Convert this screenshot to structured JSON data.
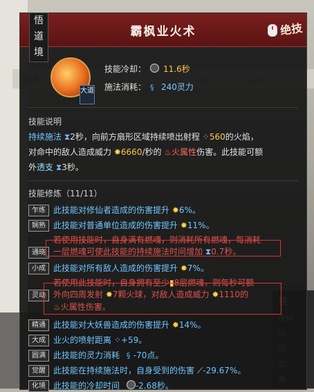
{
  "vertical_tag": [
    "悟",
    "道",
    "境"
  ],
  "background": {
    "tabs": [
      "武技",
      "法",
      "心法"
    ],
    "right_heading": "技",
    "right_rows": [
      "炼体",
      "风",
      "虫",
      "血",
      "毒"
    ]
  },
  "panel": {
    "title": "霸枫业火术",
    "brand": "绝技",
    "skill_badge": "大道",
    "cooldown_label": "技能冷却：",
    "cooldown_value": "11.6秒",
    "cost_label": "施法消耗：",
    "cost_value": "240灵力",
    "desc_title": "技能说明",
    "desc": {
      "p1": "持续施法",
      "p2": "2秒，向前方扇形区域持续喷出射程",
      "p3": "560",
      "p4": "的火焰，",
      "p5": "对命中的敌人造成威力",
      "p6": "6660",
      "p7": "/秒的",
      "p8": "火属性",
      "p9": "伤害。此技能可额",
      "p10": "外",
      "p11": "透支",
      "p12": "3秒。"
    },
    "mods_title": "技能修炼（11/11）",
    "mods": [
      {
        "tag": "乍练",
        "text": "此技能对修仙者造成的伤害提升",
        "value": "6%。"
      },
      {
        "tag": "娴熟",
        "text": "此技能对普通单位造成的伤害提升",
        "value": "11%。"
      },
      {
        "tag": "通晓",
        "text": "若使用技能时，自身满有燃魂，则消耗所有燃魂，每消耗一层燃魂可使此技能的持续施法时间增加",
        "value": "0.7秒。"
      },
      {
        "tag": "小成",
        "text": "此技能对所有敌人造成的伤害提升",
        "value": "7%。"
      },
      {
        "tag": "灵动",
        "text": "若使用此技能时，自身拥有至少",
        "value": "8层燃魂，则每秒可额外向四周发射 7颗火球，对敌人造成威力 1110的 火属性伤害。"
      },
      {
        "tag": "精通",
        "text": "此技能对大妖兽造成的伤害提升",
        "value": "14%。"
      },
      {
        "tag": "大成",
        "text": "业火的喷射距离",
        "value": "+59。"
      },
      {
        "tag": "圆满",
        "text": "此技能的灵力消耗",
        "value": "-70点。"
      },
      {
        "tag": "觉醒",
        "text": "此技能在持续施法时，自身受到的伤害",
        "value": "-29.67%。"
      },
      {
        "tag": "化境",
        "text": "此技能的冷却时间",
        "value": "-2.68秒。"
      }
    ],
    "tongxiao_line1": "若使用技能时，自身满有燃魂，则消耗所有燃魂，每消耗",
    "tongxiao_line2a": "一层燃魂可使此技能的持续施法时间增加",
    "tongxiao_value": "0.7秒。",
    "lingdong_line1": "若使用此技能时，自身拥有至少",
    "lingdong_line1b": "8层燃魂，则每秒可额",
    "lingdong_line2a": "外向四周发射",
    "lingdong_line2b": "7颗火球，对敌人造成威力",
    "lingdong_line2c": "1110的",
    "lingdong_line3": "火属性伤害。"
  }
}
